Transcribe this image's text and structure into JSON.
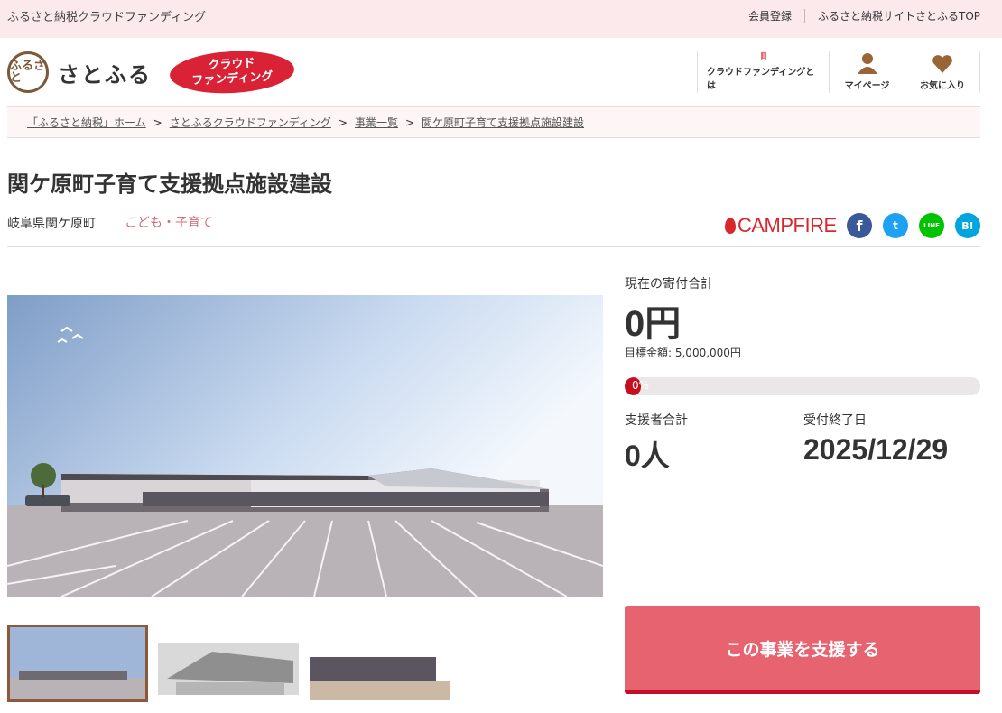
{
  "topbar": {
    "site_name": "ふるさと納税クラウドファンディング",
    "register": "会員登録",
    "top_link": "ふるさと納税サイトさとふるTOP"
  },
  "header": {
    "logo_mark": "ふるさと",
    "logo_text": "さとふる",
    "badge_line1": "クラウド",
    "badge_line2": "ファンディング",
    "nav": [
      {
        "label": "クラウドファンディングとは",
        "icon": "book-icon"
      },
      {
        "label": "マイページ",
        "icon": "person-icon"
      },
      {
        "label": "お気に入り",
        "icon": "heart-icon"
      }
    ]
  },
  "breadcrumb": [
    "「ふるさと納税」ホーム",
    "さとふるクラウドファンディング",
    "事業一覧",
    "関ケ原町子育て支援拠点施設建設"
  ],
  "project": {
    "title": "関ケ原町子育て支援拠点施設建設",
    "region": "岐阜県関ケ原町",
    "category": "こども・子育て",
    "partner": "CAMPFIRE"
  },
  "social": {
    "facebook": "f",
    "twitter": "t",
    "line": "LINE",
    "hatena": "B!"
  },
  "stats": {
    "total_label": "現在の寄付合計",
    "total_value": "0円",
    "goal": "目標金額: 5,000,000円",
    "progress_text": "0%",
    "progress_fraction": 0.03,
    "backers_label": "支援者合計",
    "backers_value": "0人",
    "deadline_label": "受付終了日",
    "deadline_value": "2025/12/29"
  },
  "cta": {
    "label": "この事業を支援する"
  },
  "colors": {
    "accent": "#e6636f",
    "brand_red": "#d92236",
    "progress": "#c70d1e"
  }
}
